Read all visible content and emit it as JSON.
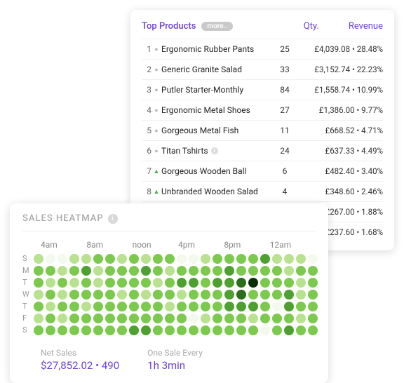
{
  "topProducts": {
    "title": "Top Products",
    "more": "more..",
    "qtyHeader": "Qty.",
    "revenueHeader": "Revenue",
    "rows": [
      {
        "rank": "1",
        "trend": "flat",
        "name": "Ergonomic Rubber Pants",
        "info": false,
        "qty": "25",
        "rev": "£4,039.08 • 28.48%"
      },
      {
        "rank": "2",
        "trend": "flat",
        "name": "Generic Granite Salad",
        "info": false,
        "qty": "33",
        "rev": "£3,152.74 • 22.23%"
      },
      {
        "rank": "3",
        "trend": "flat",
        "name": "Putler Starter-Monthly",
        "info": false,
        "qty": "84",
        "rev": "£1,558.74 • 10.99%"
      },
      {
        "rank": "4",
        "trend": "flat",
        "name": "Ergonomic Metal Shoes",
        "info": false,
        "qty": "27",
        "rev": "£1,386.00 • 9.77%"
      },
      {
        "rank": "5",
        "trend": "flat",
        "name": "Gorgeous Metal Fish",
        "info": false,
        "qty": "11",
        "rev": "£668.52 • 4.71%"
      },
      {
        "rank": "6",
        "trend": "flat",
        "name": "Titan Tshirts",
        "info": true,
        "qty": "24",
        "rev": "£637.33 • 4.49%"
      },
      {
        "rank": "7",
        "trend": "up",
        "name": "Gorgeous Wooden Ball",
        "info": false,
        "qty": "6",
        "rev": "£482.40 • 3.40%"
      },
      {
        "rank": "8",
        "trend": "up",
        "name": "Unbranded Wooden Salad",
        "info": false,
        "qty": "4",
        "rev": "£348.60 • 2.46%"
      },
      {
        "rank": "",
        "trend": "",
        "name": "",
        "info": false,
        "qty": "",
        "rev": "£267.00 • 1.88%"
      },
      {
        "rank": "",
        "trend": "",
        "name": "",
        "info": false,
        "qty": "",
        "rev": "£237.60 • 1.68%"
      }
    ]
  },
  "heatmap": {
    "title": "SALES HEATMAP",
    "hours": [
      "4am",
      "8am",
      "noon",
      "4pm",
      "8pm",
      "12am"
    ],
    "days": [
      "S",
      "M",
      "T",
      "W",
      "T",
      "F",
      "S"
    ],
    "grid": [
      [
        1,
        0,
        0,
        1,
        1,
        2,
        2,
        1,
        2,
        1,
        2,
        2,
        0,
        0,
        1,
        2,
        2,
        2,
        2,
        3,
        1,
        1,
        1,
        0
      ],
      [
        2,
        2,
        1,
        2,
        3,
        1,
        2,
        2,
        2,
        3,
        2,
        1,
        2,
        2,
        2,
        2,
        3,
        2,
        2,
        2,
        2,
        1,
        2,
        2
      ],
      [
        2,
        1,
        2,
        1,
        2,
        1,
        2,
        2,
        2,
        2,
        1,
        2,
        3,
        3,
        2,
        3,
        3,
        4,
        5,
        2,
        2,
        2,
        1,
        2
      ],
      [
        1,
        2,
        1,
        2,
        2,
        2,
        2,
        1,
        2,
        1,
        2,
        2,
        1,
        2,
        2,
        2,
        3,
        4,
        2,
        2,
        2,
        3,
        1,
        2
      ],
      [
        2,
        1,
        2,
        2,
        1,
        2,
        2,
        2,
        2,
        2,
        2,
        1,
        2,
        2,
        2,
        2,
        3,
        3,
        3,
        2,
        0,
        3,
        2,
        2
      ],
      [
        1,
        2,
        1,
        2,
        2,
        2,
        2,
        2,
        2,
        2,
        2,
        2,
        2,
        0,
        1,
        2,
        2,
        2,
        1,
        2,
        2,
        2,
        1,
        2
      ],
      [
        2,
        2,
        2,
        2,
        2,
        2,
        2,
        2,
        3,
        3,
        2,
        2,
        2,
        2,
        2,
        2,
        2,
        2,
        2,
        0,
        2,
        3,
        2,
        2
      ]
    ],
    "palette": [
      "#f3f9ed",
      "#b8e28f",
      "#7bc94d",
      "#4ea030",
      "#2b6e1c",
      "#0a2f06"
    ]
  },
  "stats": {
    "netSalesLabel": "Net Sales",
    "netSalesValue": "$27,852.02 • 490",
    "oneSaleLabel": "One Sale Every",
    "oneSaleValue": "1h 3min"
  }
}
